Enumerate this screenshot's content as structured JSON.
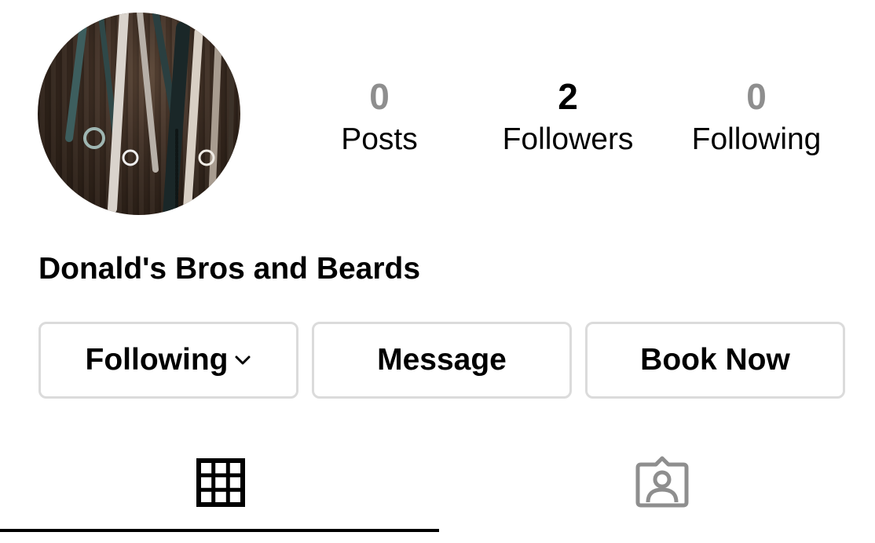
{
  "profile": {
    "avatar_icon": "avatar-photo-scissors",
    "name": "Donald's Bros and Beards"
  },
  "stats": {
    "posts": {
      "count": "0",
      "label": "Posts"
    },
    "followers": {
      "count": "2",
      "label": "Followers"
    },
    "following": {
      "count": "0",
      "label": "Following"
    }
  },
  "actions": {
    "following_label": "Following",
    "following_icon": "chevron-down-icon",
    "message_label": "Message",
    "book_label": "Book Now"
  },
  "tabs": [
    {
      "icon": "grid-icon",
      "active": true
    },
    {
      "icon": "tagged-person-icon",
      "active": false
    }
  ],
  "colors": {
    "text": "#000000",
    "muted_count": "#8e8e8e",
    "button_border": "#dbdbdb",
    "inactive_tab_icon": "#8e8e8e"
  }
}
